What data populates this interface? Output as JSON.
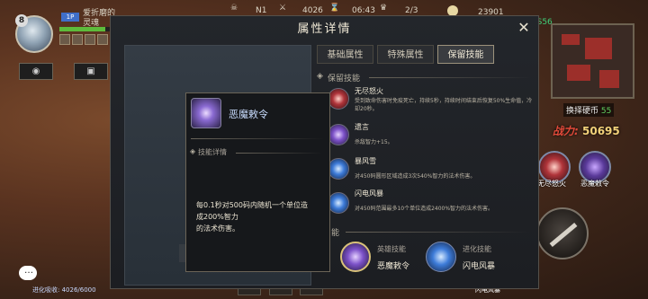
{
  "hud": {
    "player_level": "8",
    "party_tag": "1P",
    "player_name": "爱折磨的灵魂",
    "kill_count": "N1",
    "gold": "4026",
    "timer": "06:43",
    "wave": "2/3",
    "crystals": "23901",
    "fps": "FPS56",
    "coin_label": "换择硬币",
    "coin_value": "55",
    "power_label": "战力:",
    "power_value": "50695",
    "exp": "进化吸收: 4026/6000",
    "hp_fraction": 0.85
  },
  "right_skills": [
    {
      "label": "无尽怒火"
    },
    {
      "label": "恶魔敕令"
    }
  ],
  "bottom_buttons": [
    "Lv.9",
    "Lv.8",
    "Lv.9"
  ],
  "bottom_right_label": "闪电风暴",
  "dialog": {
    "title": "属性详情",
    "close_glyph": "✕",
    "tabs": [
      {
        "label": "基础属性",
        "active": false
      },
      {
        "label": "特殊属性",
        "active": false
      },
      {
        "label": "保留技能",
        "active": true
      }
    ],
    "section_title": "保留技能",
    "skills": [
      {
        "name": "无尽怒火",
        "desc": "受到致命伤害时免疫死亡，持续5秒，持续时间结束后恢复50%生命值，冷却20秒。",
        "color": "red"
      },
      {
        "name": "遗言",
        "desc": "杀敌智力+15。",
        "color": "purple"
      },
      {
        "name": "暴风雪",
        "desc": "对450码圆形区域造成3次540%智力的法术伤害。",
        "color": "blue"
      },
      {
        "name": "闪电风暴",
        "desc": "对450码范围最多10个单位造成2400%智力的法术伤害。",
        "color": "blue"
      }
    ],
    "bottom_section_partial": "能",
    "hero_skill": {
      "type": "英雄技能",
      "name": "恶魔敕令"
    },
    "evo_skill": {
      "type": "进化技能",
      "name": "闪电风暴"
    },
    "power_strip_value": "50695"
  },
  "popup": {
    "title": "恶魔敕令",
    "detail_label": "技能详情",
    "desc_line1": "每0.1秒对500码内随机一个单位造",
    "desc_line2": "成200%智力",
    "desc_line3": "的法术伤害。"
  }
}
